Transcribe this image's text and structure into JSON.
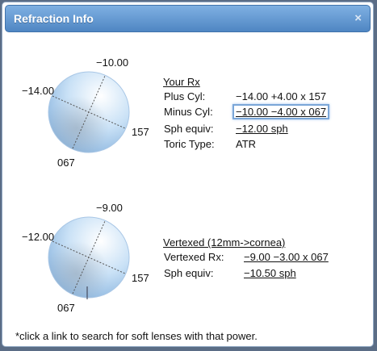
{
  "dialog": {
    "title": "Refraction Info",
    "close_glyph": "×"
  },
  "diagram1": {
    "top_label": "−10.00",
    "left_label": "−14.00",
    "right_label": "157",
    "bottom_label": "067"
  },
  "your_rx": {
    "heading": "Your Rx",
    "plus_cyl_label": "Plus Cyl:",
    "plus_cyl_value": "−14.00 +4.00 x 157",
    "minus_cyl_label": "Minus Cyl:",
    "minus_cyl_value": "−10.00 −4.00 x 067",
    "sph_equiv_label": "Sph equiv:",
    "sph_equiv_value": "−12.00 sph",
    "toric_label": "Toric Type:",
    "toric_value": "ATR"
  },
  "diagram2": {
    "top_label": "−9.00",
    "left_label": "−12.00",
    "right_label": "157",
    "bottom_label": "067"
  },
  "vertexed": {
    "heading": "Vertexed (12mm->cornea)",
    "rx_label": "Vertexed Rx:",
    "rx_value": "−9.00 −3.00 x 067",
    "sph_equiv_label": "Sph equiv:",
    "sph_equiv_value": "−10.50 sph"
  },
  "footer_note": "*click a link to search for soft lenses with that power.",
  "colors": {
    "title_bar": "#5e93cf",
    "globe": "#bcd9f3"
  }
}
